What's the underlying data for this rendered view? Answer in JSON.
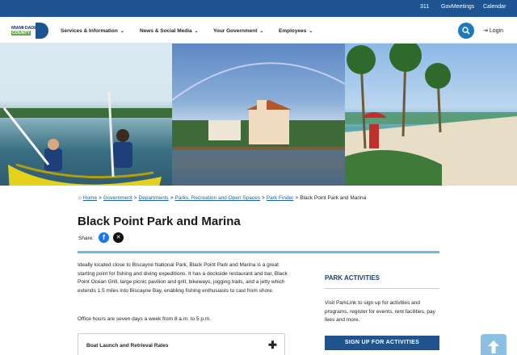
{
  "utility": {
    "links": [
      "311",
      "GovMeetings",
      "Calendar"
    ]
  },
  "logo": {
    "line1": "MIAMI·DADE",
    "line2": "COUNTY"
  },
  "nav": {
    "items": [
      "Services & Information",
      "News & Social Media",
      "Your Government",
      "Employees"
    ],
    "login": "Login"
  },
  "breadcrumb": {
    "home": "Home",
    "links": [
      "Government",
      "Departments",
      "Parks, Recreation and Open Spaces",
      "Park Finder"
    ],
    "current": "Black Point Park and Marina"
  },
  "page": {
    "title": "Black Point Park and Marina",
    "share_label": "Share:",
    "intro": "Ideally located close to Biscayne National Park, Black Point Park and Marina is a great starting point for fishing and diving expeditions. It has a dockside restaurant and bar, Black Point Ocean Grill, large picnic pavilion and grill, bikeways, jogging trails, and a jetty which extends 1.5 miles into Biscayne Bay, enabling fishing enthusiasts to cast from shore.",
    "hours": "Office hours are seven days a week from 8 a.m. to 5 p.m.",
    "accordion_label": "Boat Launch and Retrieval Rates"
  },
  "sidebar": {
    "heading": "PARK ACTIVITIES",
    "text": "Visit ParkLink to sign up for activities and programs, register for events, rent facilities, pay fees and more.",
    "button": "SIGN UP FOR ACTIVITIES"
  },
  "colors": {
    "utility_bar": "#1e5491",
    "accent": "#71b8e0",
    "button": "#21538f",
    "link": "#1a5fa8"
  },
  "icons": [
    "search-icon",
    "user-icon",
    "home-icon",
    "facebook-icon",
    "x-icon",
    "plus-icon",
    "arrow-up-icon",
    "chevron-down-icon"
  ]
}
